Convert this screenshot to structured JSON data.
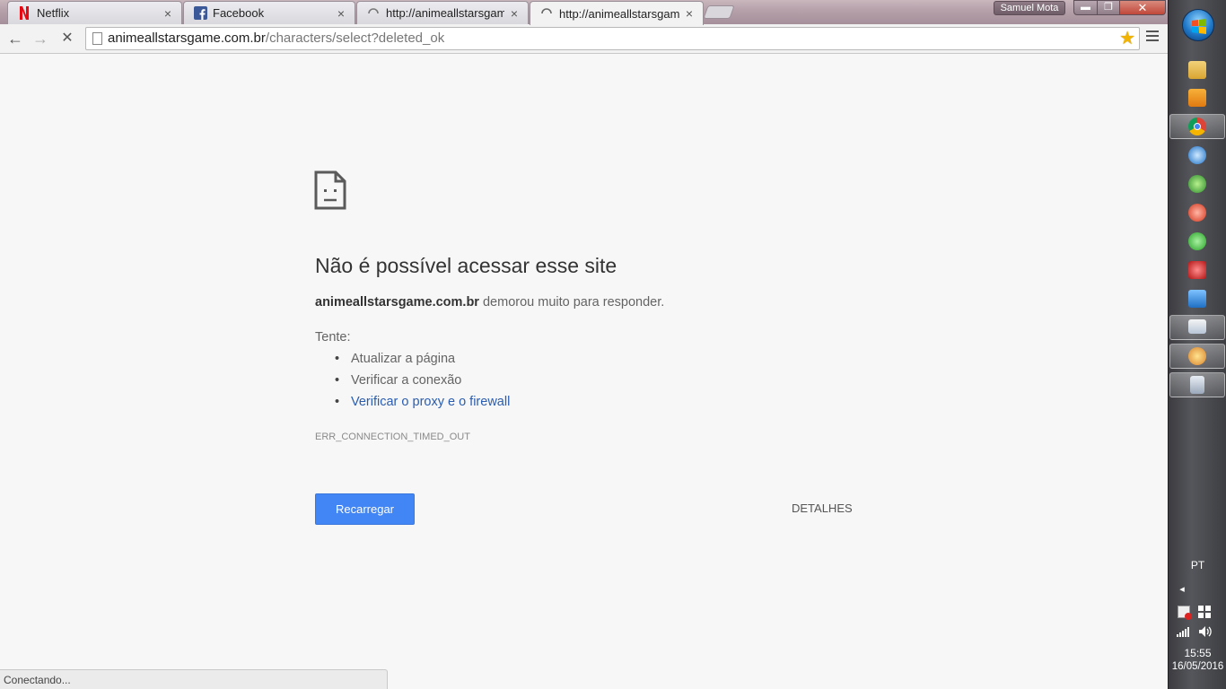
{
  "window": {
    "user_name": "Samuel Mota",
    "min_symbol": "▬",
    "max_symbol": "❐",
    "close_symbol": "✕"
  },
  "tabs": [
    {
      "title": "Netflix",
      "icon": "netflix-icon",
      "close": "×"
    },
    {
      "title": "Facebook",
      "icon": "facebook-icon",
      "close": "×"
    },
    {
      "title": "http://animeallstarsgame.",
      "icon": "loading-spinner-icon",
      "close": "×"
    },
    {
      "title": "http://animeallstarsgame.",
      "icon": "loading-spinner-icon",
      "close": "×",
      "active": true
    }
  ],
  "toolbar": {
    "back": "←",
    "forward": "→",
    "stop": "✕",
    "url_domain": "animeallstarsgame.com.br",
    "url_path": "/characters/select?deleted_ok",
    "star": "★"
  },
  "error_page": {
    "title": "Não é possível acessar esse site",
    "host": "animeallstarsgame.com.br",
    "description": " demorou muito para responder.",
    "try_label": "Tente:",
    "suggestions": [
      "Atualizar a página",
      "Verificar a conexão",
      "Verificar o proxy e o firewall"
    ],
    "error_code": "ERR_CONNECTION_TIMED_OUT",
    "reload_label": "Recarregar",
    "details_label": "DETALHES"
  },
  "status_bar": {
    "text": "Conectando..."
  },
  "taskbar": {
    "language": "PT",
    "time": "15:55",
    "date": "16/05/2016",
    "show_hidden": "◂",
    "colors": {
      "accent": "#4285f4",
      "link": "#2a5db0"
    }
  }
}
